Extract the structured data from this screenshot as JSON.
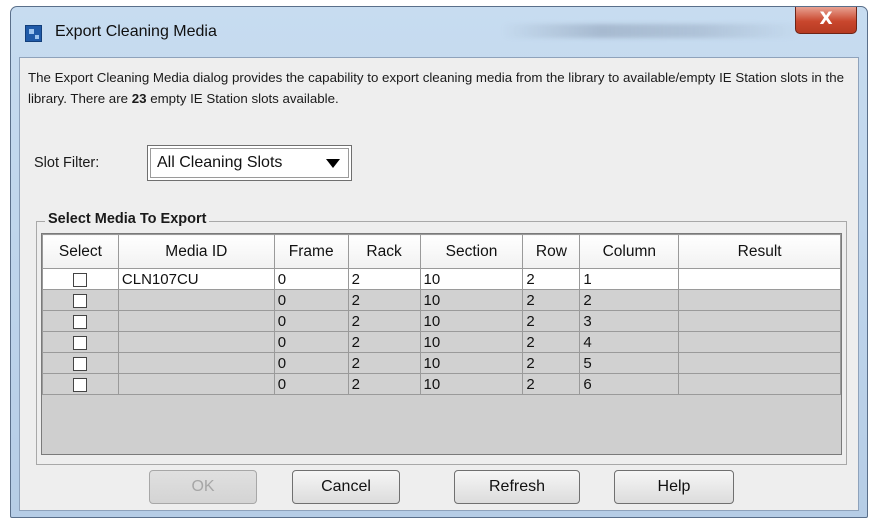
{
  "window": {
    "title": "Export Cleaning Media",
    "close_glyph": "X"
  },
  "description": {
    "part1": "The Export Cleaning Media dialog provides the capability to export cleaning media from the library to available/empty IE Station slots in the library. There are ",
    "count": "23",
    "part2": " empty IE Station slots available."
  },
  "slot_filter": {
    "label": "Slot Filter:",
    "selected": "All Cleaning Slots"
  },
  "group": {
    "title": "Select Media To Export"
  },
  "table": {
    "columns": [
      "Select",
      "Media ID",
      "Frame",
      "Rack",
      "Section",
      "Row",
      "Column",
      "Result"
    ],
    "rows": [
      {
        "media_id": "CLN107CU",
        "frame": "0",
        "rack": "2",
        "section": "10",
        "row": "2",
        "column": "1",
        "result": ""
      },
      {
        "media_id": "",
        "frame": "0",
        "rack": "2",
        "section": "10",
        "row": "2",
        "column": "2",
        "result": ""
      },
      {
        "media_id": "",
        "frame": "0",
        "rack": "2",
        "section": "10",
        "row": "2",
        "column": "3",
        "result": ""
      },
      {
        "media_id": "",
        "frame": "0",
        "rack": "2",
        "section": "10",
        "row": "2",
        "column": "4",
        "result": ""
      },
      {
        "media_id": "",
        "frame": "0",
        "rack": "2",
        "section": "10",
        "row": "2",
        "column": "5",
        "result": ""
      },
      {
        "media_id": "",
        "frame": "0",
        "rack": "2",
        "section": "10",
        "row": "2",
        "column": "6",
        "result": ""
      }
    ]
  },
  "buttons": {
    "ok": "OK",
    "cancel": "Cancel",
    "refresh": "Refresh",
    "help": "Help"
  },
  "icons": {
    "app": "app-window-icon",
    "close": "close-icon",
    "dropdown": "chevron-down-icon"
  },
  "colors": {
    "titlebar": "#c7dcf0",
    "close_button": "#c9472d",
    "dialog_bg": "#eeeeee",
    "selected_row": "#ffffff",
    "unselected_row": "#d1d1d1"
  }
}
